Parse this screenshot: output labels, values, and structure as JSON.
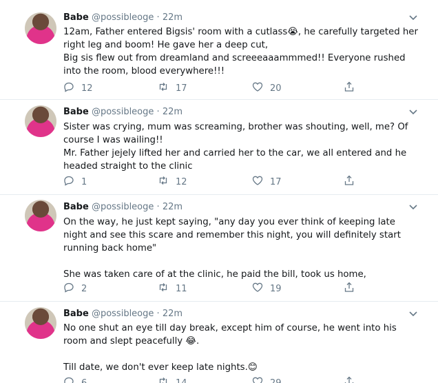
{
  "tweets": [
    {
      "name": "Babe",
      "handle": "@possibleoge",
      "dot": "·",
      "time": "22m",
      "lines": [
        "12am, Father entered Bigsis' room with a cutlass😭, he carefully targeted her right leg and boom!  He gave her a deep cut,",
        "Big sis flew out from dreamland and screeeaaammmed!!  Everyone rushed into the room,  blood everywhere!!!"
      ],
      "replies": "12",
      "retweets": "17",
      "likes": "20"
    },
    {
      "name": "Babe",
      "handle": "@possibleoge",
      "dot": "·",
      "time": "22m",
      "lines": [
        "Sister was crying, mum was screaming, brother was shouting, well, me? Of course I was wailing!!",
        "Mr. Father jejely lifted her and carried her to the car, we all entered and he headed straight to the clinic"
      ],
      "replies": "1",
      "retweets": "12",
      "likes": "17"
    },
    {
      "name": "Babe",
      "handle": "@possibleoge",
      "dot": "·",
      "time": "22m",
      "lines": [
        "On the way, he just kept saying, \"any day you ever think of keeping late night and see this scare and remember this night, you will definitely start running back home\"",
        "",
        "She was taken care of at the clinic, he paid the bill, took us home,"
      ],
      "replies": "2",
      "retweets": "11",
      "likes": "19"
    },
    {
      "name": "Babe",
      "handle": "@possibleoge",
      "dot": "·",
      "time": "22m",
      "lines": [
        "No one shut an eye till day break, except him of course, he went into his room and slept peacefully 😂.",
        "",
        "Till date, we don't ever keep late nights.😊"
      ],
      "replies": "6",
      "retweets": "14",
      "likes": "29"
    }
  ]
}
